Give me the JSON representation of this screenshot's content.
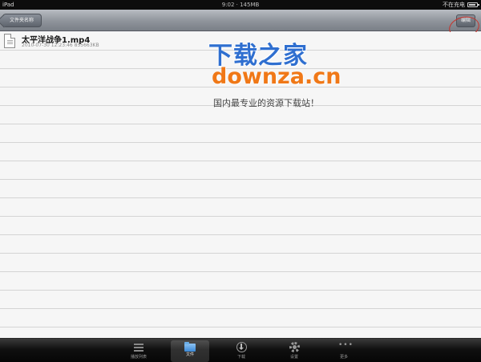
{
  "status_bar": {
    "carrier": "iPad",
    "time": "9:02 · 145MB",
    "charge_status": "不在充电",
    "battery_level": 0.85
  },
  "nav_bar": {
    "back_label": "文件夹名称",
    "edit_label": "编辑"
  },
  "files": [
    {
      "name": "太平洋战争1.mp4",
      "date": "2010-07-30 12:23:46",
      "size": "855663KB",
      "icon": "document-icon"
    }
  ],
  "watermark": {
    "site_cn": "下载之家",
    "site_domain": "downza.cn",
    "slogan": "国内最专业的资源下载站！"
  },
  "tab_bar": {
    "items": [
      {
        "label": "播放列表",
        "icon": "list-icon"
      },
      {
        "label": "文件",
        "icon": "folder-icon",
        "active": true
      },
      {
        "label": "下载",
        "icon": "download-icon"
      },
      {
        "label": "设置",
        "icon": "gear-icon"
      },
      {
        "label": "更多",
        "icon": "more-icon"
      }
    ]
  },
  "colors": {
    "watermark_blue": "#2f6fd0",
    "watermark_orange": "#f07817",
    "annotation_red": "#c8322a",
    "tab_active_icon": "#3a88d6"
  }
}
